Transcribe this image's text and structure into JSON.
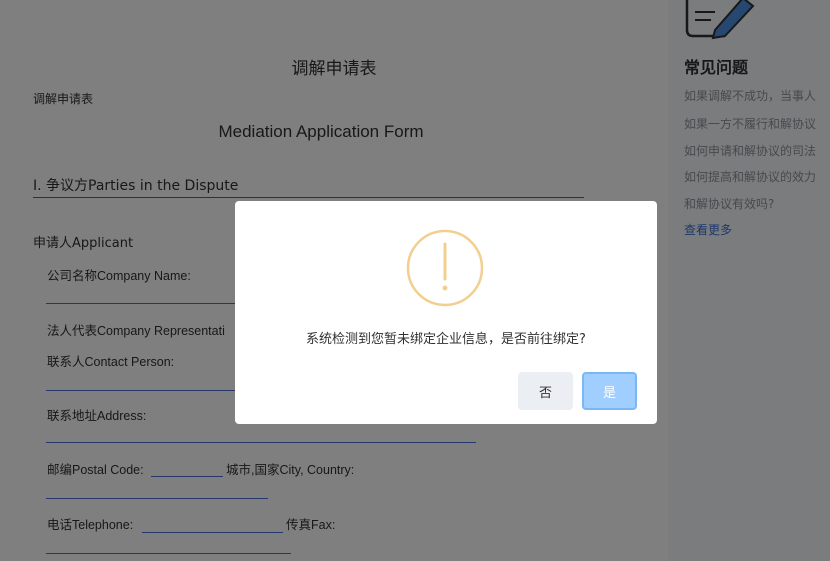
{
  "form": {
    "title": "调解申请表",
    "subtitle": "调解申请表",
    "title_en": "Mediation Application Form",
    "section1": "I. 争议方Parties in the Dispute",
    "applicant": "申请人Applicant",
    "company_name": "公司名称Company Name:",
    "legal_rep": "法人代表Company Representati",
    "contact": "联系人Contact Person:",
    "address": "联系地址Address:",
    "postal": "邮编Postal Code:",
    "city": "城市,国家City, Country:",
    "phone": "电话Telephone:",
    "fax": "传真Fax:"
  },
  "sidebar": {
    "title": "常见问题",
    "items": [
      "如果调解不成功，当事人",
      "如果一方不履行和解协议",
      "如何申请和解协议的司法",
      "如何提高和解协议的效力",
      "和解协议有效吗?"
    ],
    "more": "查看更多"
  },
  "dialog": {
    "message": "系统检测到您暂未绑定企业信息，是否前往绑定?",
    "cancel_label": "否",
    "confirm_label": "是",
    "icon": "warning-icon"
  },
  "colors": {
    "warning": "#e6a23c",
    "primary_light": "#a0cfff",
    "link": "#3d6fd6",
    "underline": "#4a6fd6"
  }
}
